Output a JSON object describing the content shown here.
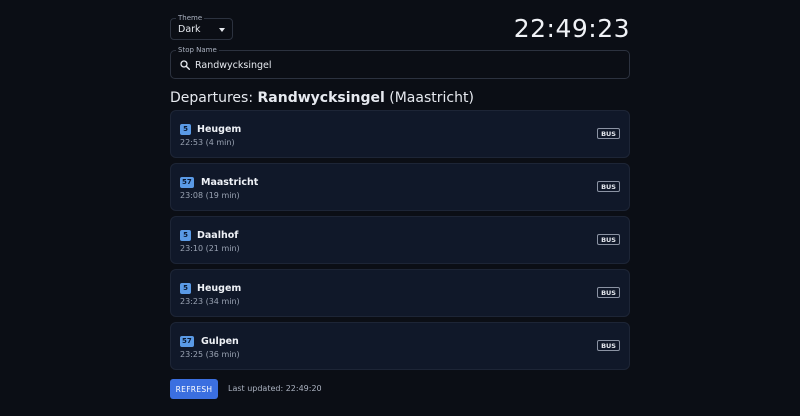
{
  "theme": {
    "label": "Theme",
    "value": "Dark"
  },
  "clock": "22:49:23",
  "stop": {
    "label": "Stop Name",
    "value": "Randwycksingel"
  },
  "heading": {
    "prefix": "Departures: ",
    "stop": "Randwycksingel",
    "city": " (Maastricht)"
  },
  "departures": [
    {
      "line": "5",
      "destination": "Heugem",
      "time": "22:53 (4 min)",
      "mode": "BUS"
    },
    {
      "line": "57",
      "destination": "Maastricht",
      "time": "23:08 (19 min)",
      "mode": "BUS"
    },
    {
      "line": "5",
      "destination": "Daalhof",
      "time": "23:10 (21 min)",
      "mode": "BUS"
    },
    {
      "line": "5",
      "destination": "Heugem",
      "time": "23:23 (34 min)",
      "mode": "BUS"
    },
    {
      "line": "57",
      "destination": "Gulpen",
      "time": "23:25 (36 min)",
      "mode": "BUS"
    }
  ],
  "footer": {
    "refresh_label": "REFRESH",
    "last_updated": "Last updated: 22:49:20"
  },
  "colors": {
    "background": "#0b0e15",
    "card": "#101829",
    "line_badge": "#5a9ae6",
    "refresh_button": "#3b6fe0"
  },
  "icons": {
    "search": "search-icon",
    "dropdown": "chevron-down-icon"
  }
}
